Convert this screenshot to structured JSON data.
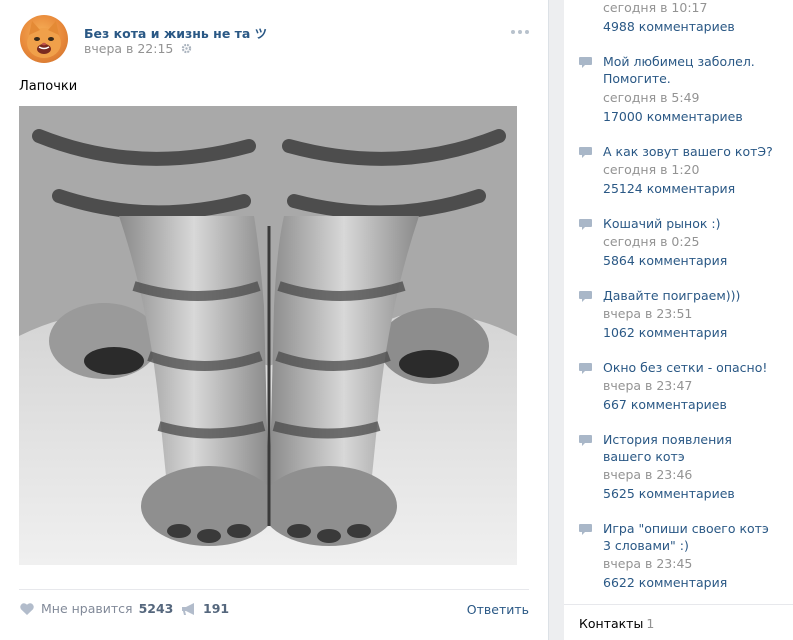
{
  "post": {
    "author": "Без кота и жизнь не та ツ",
    "time": "вчера в 22:15",
    "text": "Лапочки",
    "like_label": "Мне нравится",
    "like_count": "5243",
    "share_count": "191",
    "reply_label": "Ответить",
    "link_color": "#2a5885"
  },
  "discussions": [
    {
      "title": "",
      "meta": "сегодня в 10:17",
      "comments": "4988 комментариев"
    },
    {
      "title": "Мой любимец заболел. Помогите.",
      "meta": "сегодня в 5:49",
      "comments": "17000 комментариев"
    },
    {
      "title": "А как зовут вашего котЭ?",
      "meta": "сегодня в 1:20",
      "comments": "25124 комментария"
    },
    {
      "title": "Кошачий рынок :)",
      "meta": "сегодня в 0:25",
      "comments": "5864 комментария"
    },
    {
      "title": "Давайте поиграем)))",
      "meta": "вчера в 23:51",
      "comments": "1062 комментария"
    },
    {
      "title": "Окно без сетки - опасно!",
      "meta": "вчера в 23:47",
      "comments": "667 комментариев"
    },
    {
      "title": "История появления вашего котэ",
      "meta": "вчера в 23:46",
      "comments": "5625 комментариев"
    },
    {
      "title": "Игра \"опиши своего котэ 3 словами\" :)",
      "meta": "вчера в 23:45",
      "comments": "6622 комментария"
    }
  ],
  "contacts": {
    "label": "Контакты",
    "count": "1"
  }
}
